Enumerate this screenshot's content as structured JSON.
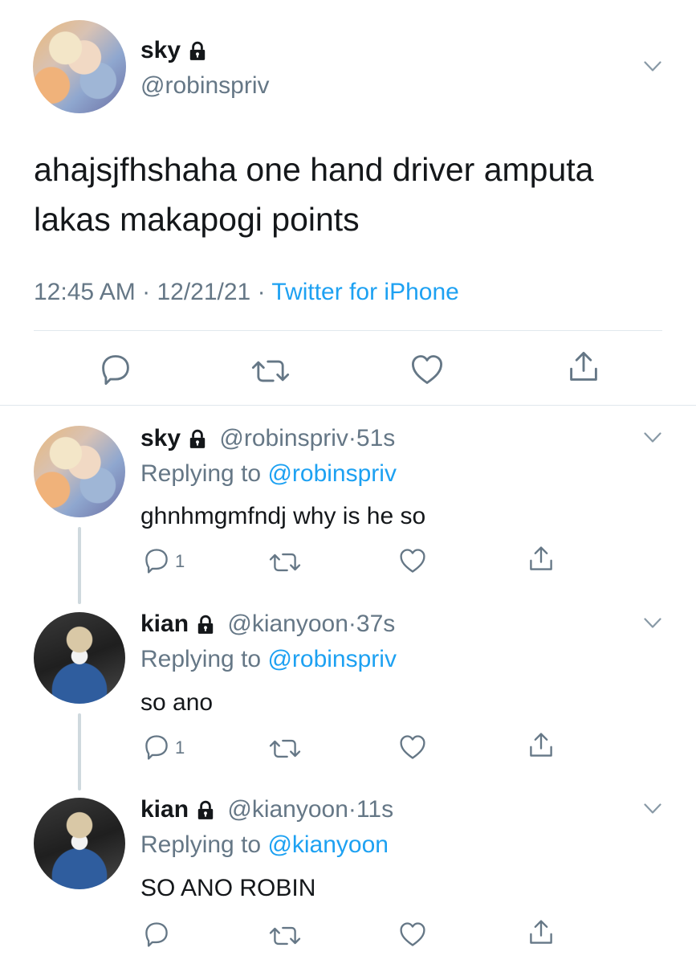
{
  "main_tweet": {
    "name": "sky",
    "handle": "@robinspriv",
    "text": "ahajsjfhshaha one hand driver amputa lakas makapogi points",
    "time": "12:45 AM",
    "date": "12/21/21",
    "source": "Twitter for iPhone",
    "sep": "·"
  },
  "replies": [
    {
      "name": "sky",
      "handle": "@robinspriv",
      "time": "51s",
      "replying_prefix": "Replying to",
      "replying_to": "@robinspriv",
      "text": "ghnhmgmfndj why is he so",
      "reply_count": "1"
    },
    {
      "name": "kian",
      "handle": "@kianyoon",
      "time": "37s",
      "replying_prefix": "Replying to",
      "replying_to": "@robinspriv",
      "text": "so ano",
      "reply_count": "1"
    },
    {
      "name": "kian",
      "handle": "@kianyoon",
      "time": "11s",
      "replying_prefix": "Replying to",
      "replying_to": "@kianyoon",
      "text": "SO ANO ROBIN",
      "reply_count": ""
    }
  ],
  "icons": [
    "lock-icon",
    "chevron-down-icon",
    "reply-icon",
    "retweet-icon",
    "like-icon",
    "share-icon"
  ],
  "colors": {
    "link": "#1da1f2",
    "secondary": "#657786",
    "text": "#14171a",
    "divider": "#e1e8ed"
  }
}
